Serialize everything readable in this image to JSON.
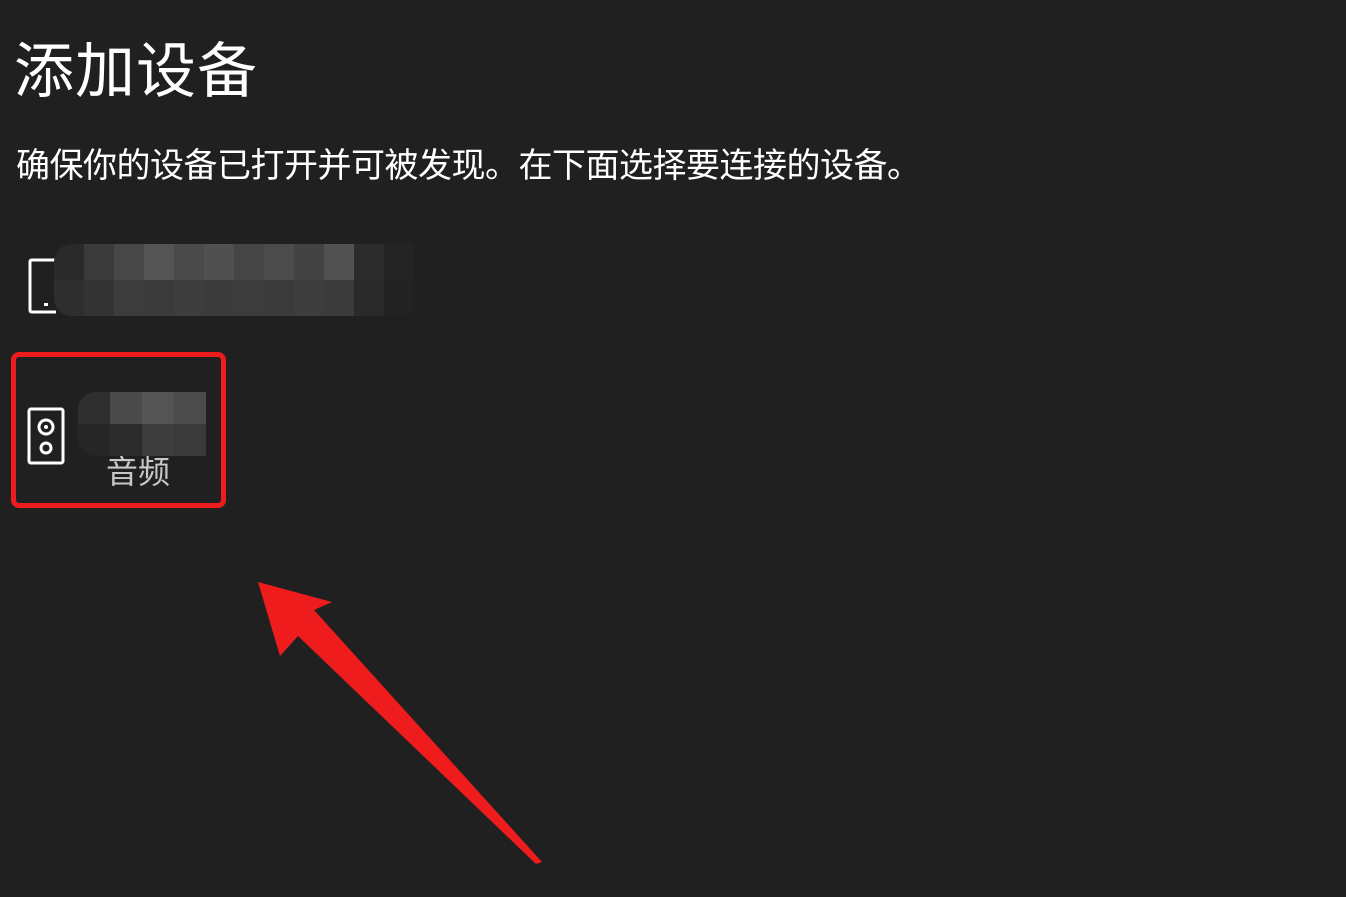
{
  "page": {
    "title": "添加设备",
    "instructions": "确保你的设备已打开并可被发现。在下面选择要连接的设备。"
  },
  "devices": [
    {
      "icon": "device-display-icon",
      "name": "",
      "type": "",
      "obscured": true
    },
    {
      "icon": "speaker-icon",
      "name": "",
      "type": "音频",
      "obscured": true,
      "highlighted": true
    }
  ],
  "annotation": {
    "highlight_color": "#ee1c1c",
    "arrow_color": "#ee1c1c"
  },
  "colors": {
    "background": "#202020",
    "text": "#ffffff",
    "secondary_text": "#c8c8c8"
  }
}
